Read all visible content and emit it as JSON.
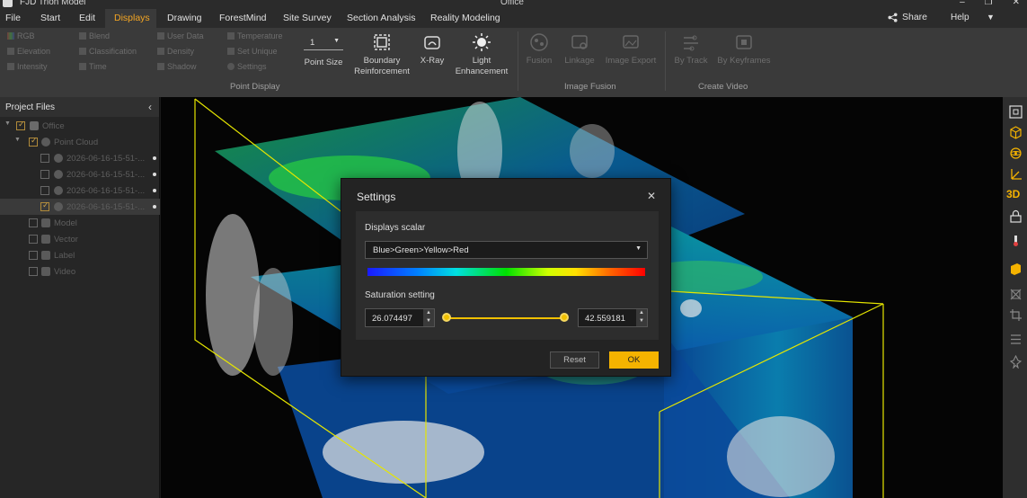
{
  "app": {
    "title": "FJD Trion Model",
    "window_title": "Office"
  },
  "window_controls": [
    "–",
    "❐",
    "✕"
  ],
  "menu": {
    "items": [
      "File",
      "Start",
      "Edit",
      "Displays",
      "Drawing",
      "ForestMind",
      "Site Survey",
      "Section Analysis",
      "Reality Modeling"
    ],
    "active": "Displays",
    "share": "Share",
    "help": "Help"
  },
  "ribbon": {
    "point_display": {
      "col1": [
        "RGB",
        "Elevation",
        "Intensity"
      ],
      "col2": [
        "Blend",
        "Classification",
        "Time"
      ],
      "col3": [
        "User Data",
        "Density",
        "Shadow"
      ],
      "col4": [
        "Temperature",
        "Set Unique",
        "Settings"
      ],
      "point_size_value": "1",
      "point_size_label": "Point Size",
      "boundary_label_1": "Boundary",
      "boundary_label_2": "Reinforcement",
      "xray_label": "X-Ray",
      "light_label_1": "Light",
      "light_label_2": "Enhancement",
      "group_label": "Point Display"
    },
    "image_fusion": {
      "items": [
        "Fusion",
        "Linkage",
        "Image Export"
      ],
      "group_label": "Image Fusion"
    },
    "create_video": {
      "items": [
        "By Track",
        "By Keyframes"
      ],
      "group_label": "Create Video"
    }
  },
  "project_panel": {
    "title": "Project Files",
    "tree": [
      {
        "label": "Office",
        "checked": true
      },
      {
        "label": "Point Cloud",
        "checked": true
      },
      {
        "label": "2026-06-16-15-51-...",
        "checked": false
      },
      {
        "label": "2026-06-16-15-51-...",
        "checked": false
      },
      {
        "label": "2026-06-16-15-51-...",
        "checked": false
      },
      {
        "label": "2026-06-16-15-51-...",
        "checked": true
      },
      {
        "label": "Model",
        "checked": false
      },
      {
        "label": "Vector",
        "checked": false
      },
      {
        "label": "Label",
        "checked": false
      },
      {
        "label": "Video",
        "checked": false
      }
    ]
  },
  "right_toolbar": [
    "fit-view-icon",
    "cube-view-icon",
    "orbit-icon",
    "axis-icon",
    "3d-toggle-icon",
    "lock-icon",
    "thermometer-icon",
    "box-icon",
    "clip-icon",
    "crop-icon",
    "list-icon",
    "pin-icon"
  ],
  "settings_dialog": {
    "title": "Settings",
    "displays_scalar_label": "Displays scalar",
    "scalar_value": "Blue>Green>Yellow>Red",
    "saturation_label": "Saturation setting",
    "min_value": "26.074497",
    "max_value": "42.559181",
    "reset_label": "Reset",
    "ok_label": "OK",
    "accent": "#f5b300"
  }
}
